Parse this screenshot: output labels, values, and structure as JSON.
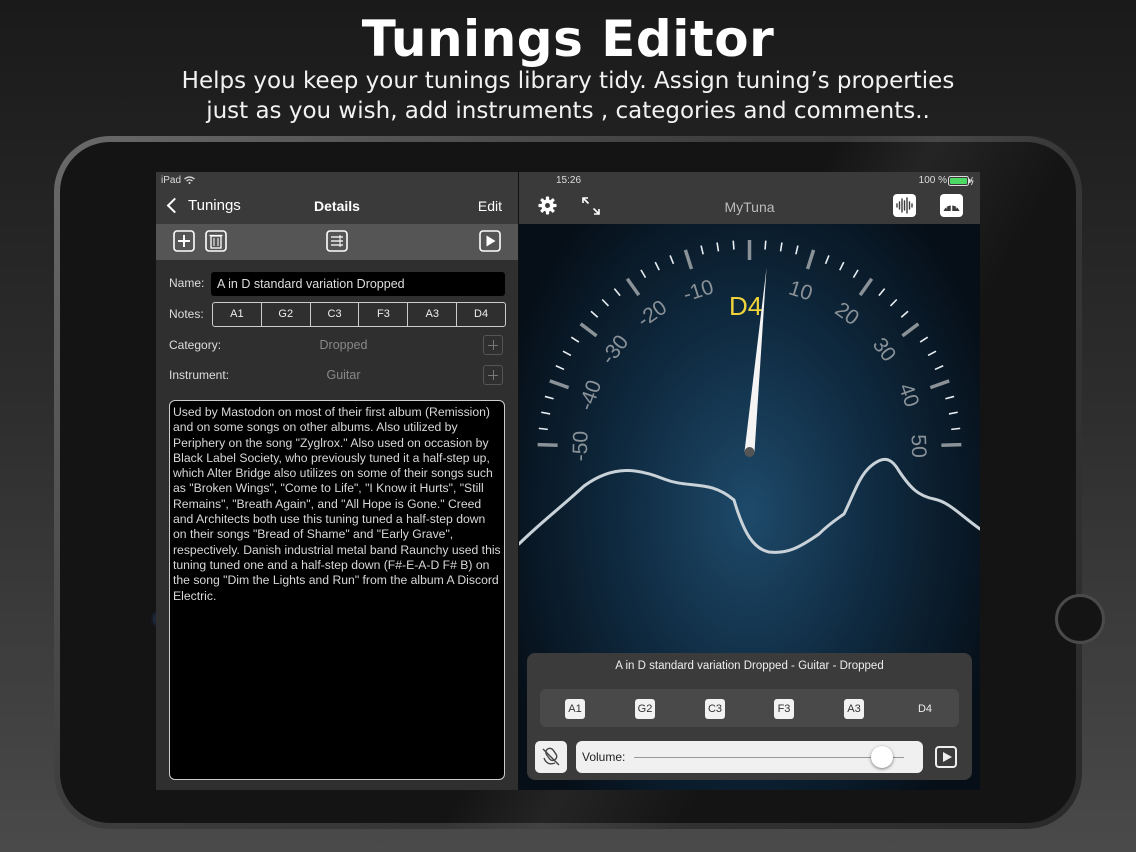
{
  "promo": {
    "title": "Tunings Editor",
    "subtitle_line1": "Helps you keep your tunings library tidy. Assign tuning’s properties",
    "subtitle_line2": "just as you wish, add instruments , categories and comments.."
  },
  "status": {
    "device": "iPad",
    "time": "15:26",
    "battery": "100 %"
  },
  "left_nav": {
    "back_label": "Tunings",
    "title": "Details",
    "edit_label": "Edit"
  },
  "toolbar": {
    "icons": [
      "add-icon",
      "trash-icon",
      "list-sort-icon",
      "play-icon"
    ]
  },
  "form": {
    "name_label": "Name:",
    "name_value": "A in D standard variation Dropped",
    "notes_label": "Notes:",
    "notes": [
      "A1",
      "G2",
      "C3",
      "F3",
      "A3",
      "D4"
    ],
    "category_label": "Category:",
    "category_value": "Dropped",
    "instrument_label": "Instrument:",
    "instrument_value": "Guitar",
    "comment": "Used by Mastodon on most of their first album (Remission) and on some songs on other albums. Also utilized by Periphery on the song \"Zyglrox.\" Also used on occasion by Black Label Society, who previously tuned it a half-step up, which Alter Bridge also utilizes on some of their songs such as \"Broken Wings\", \"Come to Life\", \"I Know it Hurts\", \"Still Remains\", \"Breath Again\", and \"All Hope is Gone.\" Creed and Architects both use this tuning tuned a half-step down on their songs \"Bread of Shame\" and \"Early Grave\", respectively. Danish industrial metal band Raunchy used this tuning tuned one and a half-step down (F#-E-A-D F# B) on the song \"Dim the Lights and Run\" from the album A Discord Electric."
  },
  "right_nav": {
    "app_title": "MyTuna",
    "icons": [
      "gear-icon",
      "expand-icon",
      "waveform-icon",
      "gauge-icon"
    ]
  },
  "tuner": {
    "note": "D4",
    "scale_left": [
      "-10",
      "-20",
      "-30",
      "-40",
      "-50"
    ],
    "scale_right": [
      "10",
      "20",
      "30",
      "40",
      "50"
    ],
    "cents": -1
  },
  "bottom_panel": {
    "title": "A in D standard variation Dropped - Guitar - Dropped",
    "notes": [
      "A1",
      "G2",
      "C3",
      "F3",
      "A3",
      "D4"
    ],
    "active_note": "D4",
    "volume_label": "Volume:",
    "volume_level": 0.92
  }
}
